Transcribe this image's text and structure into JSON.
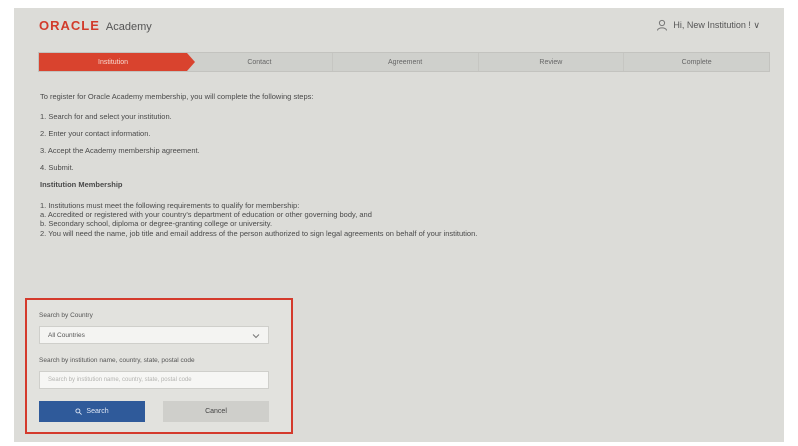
{
  "header": {
    "logo_brand": "ORACLE",
    "logo_product": "Academy",
    "user_label": "Hi, New Institution ! ∨"
  },
  "stepper": {
    "steps": [
      "Institution",
      "Contact",
      "Agreement",
      "Review",
      "Complete"
    ],
    "active_index": 0
  },
  "content": {
    "intro": "To register for Oracle Academy membership, you will complete the following steps:",
    "steps": [
      "1. Search for and select your institution.",
      "2. Enter your contact information.",
      "3. Accept the Academy membership agreement.",
      "4. Submit."
    ],
    "section_heading": "Institution Membership",
    "requirement_1": "1. Institutions must meet the following requirements to qualify for membership:",
    "requirement_1a": "a. Accredited or registered with your country's department of education or other governing body, and",
    "requirement_1b": "b. Secondary school, diploma or degree-granting college or university.",
    "requirement_2": "2. You will need the name, job title and email address of the person authorized to sign legal agreements on behalf of your institution."
  },
  "search_panel": {
    "country_label": "Search by Country",
    "country_value": "All Countries",
    "keyword_label": "Search by institution name, country, state, postal code",
    "keyword_value": "",
    "keyword_placeholder": "Search by institution name, country, state, postal code",
    "search_button": "Search",
    "cancel_button": "Cancel"
  },
  "colors": {
    "brand_red": "#d9432e",
    "highlight_border": "#d43a2c",
    "primary_button": "#2f5a9a"
  }
}
